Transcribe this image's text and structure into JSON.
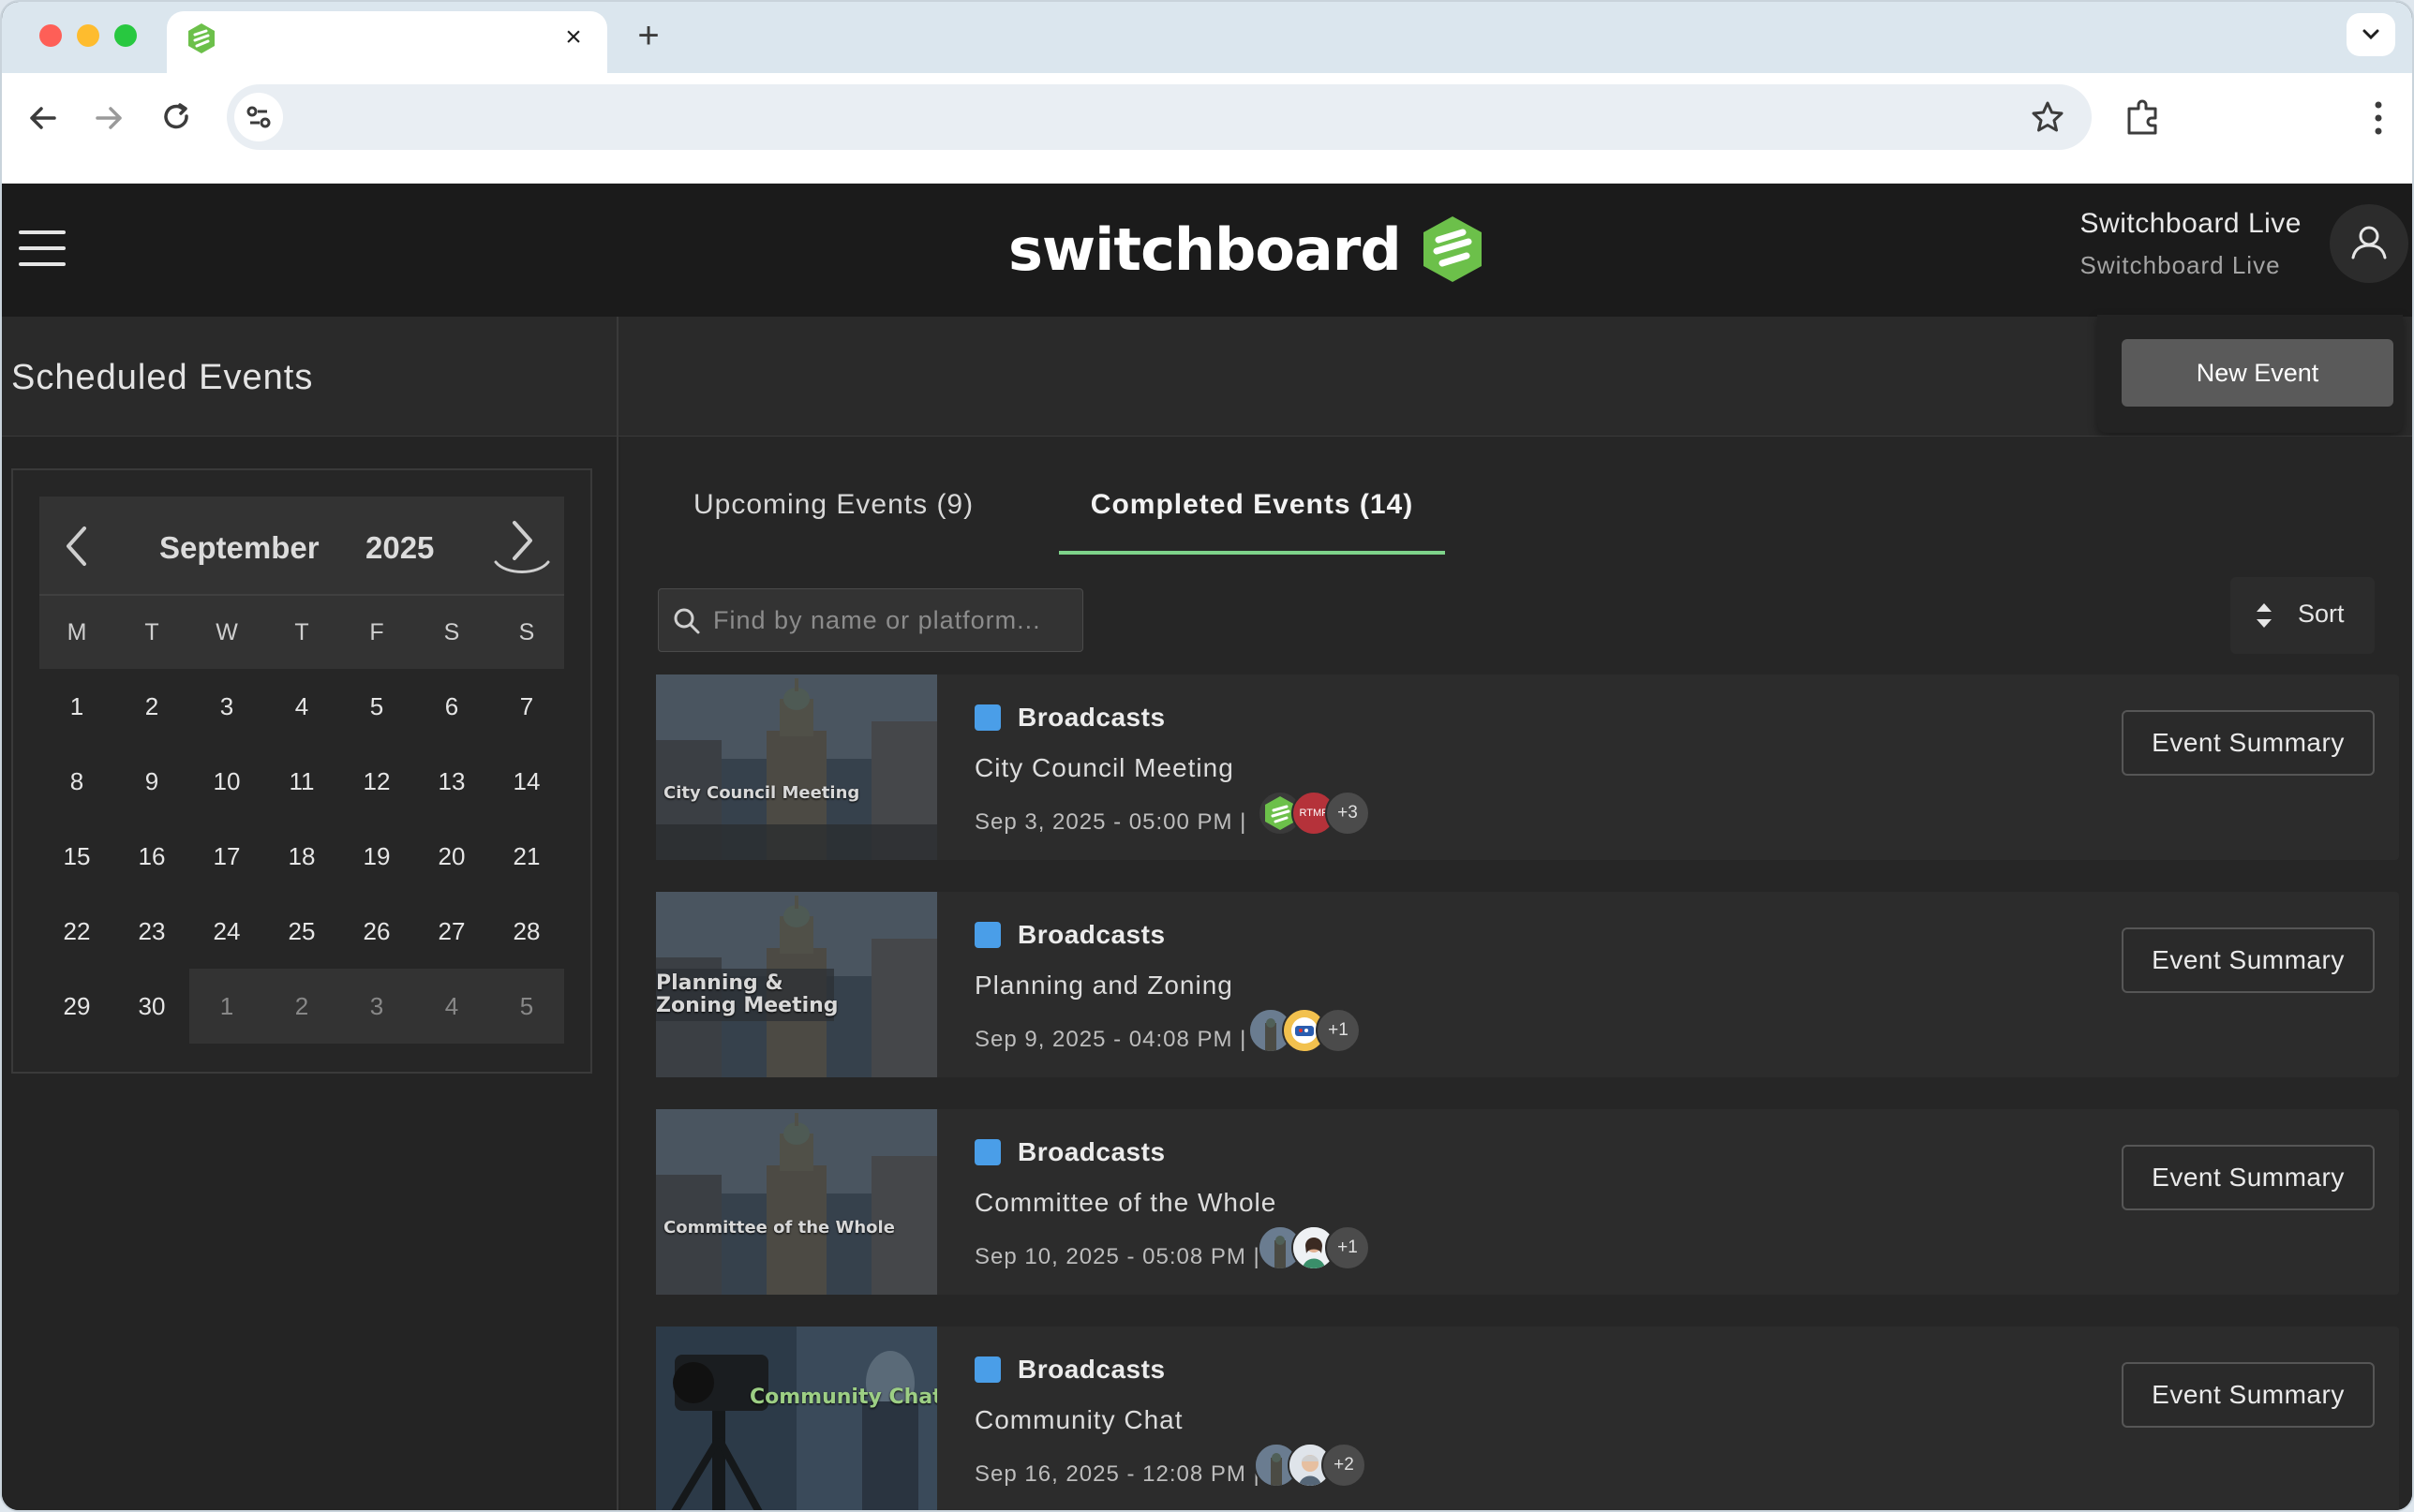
{
  "browser": {
    "tab_close": "×",
    "new_tab": "+"
  },
  "app": {
    "logo_text": "switchboard",
    "user": {
      "name": "Switchboard Live",
      "org": "Switchboard Live"
    }
  },
  "page": {
    "title": "Scheduled Events",
    "new_event_label": "New Event"
  },
  "calendar": {
    "month": "September",
    "year": "2025",
    "weekdays": [
      "M",
      "T",
      "W",
      "T",
      "F",
      "S",
      "S"
    ],
    "days": [
      "1",
      "2",
      "3",
      "4",
      "5",
      "6",
      "7",
      "8",
      "9",
      "10",
      "11",
      "12",
      "13",
      "14",
      "15",
      "16",
      "17",
      "18",
      "19",
      "20",
      "21",
      "22",
      "23",
      "24",
      "25",
      "26",
      "27",
      "28",
      "29",
      "30"
    ],
    "next_month_days": [
      "1",
      "2",
      "3",
      "4",
      "5"
    ]
  },
  "tabs": {
    "upcoming": "Upcoming Events (9)",
    "completed": "Completed Events (14)",
    "active": "completed"
  },
  "search": {
    "placeholder": "Find by name or platform..."
  },
  "sort": {
    "label": "Sort"
  },
  "events": [
    {
      "thumb_caption": "City Council Meeting",
      "tag": "Broadcasts",
      "name": "City Council Meeting",
      "date": "Sep 3, 2025 - 05:00 PM |",
      "more": "+3",
      "summary_label": "Event Summary"
    },
    {
      "thumb_caption": "Planning & Zoning Meeting",
      "tag": "Broadcasts",
      "name": "Planning and Zoning",
      "date": "Sep 9, 2025 - 04:08 PM |",
      "more": "+1",
      "summary_label": "Event Summary"
    },
    {
      "thumb_caption": "Committee of the Whole",
      "tag": "Broadcasts",
      "name": "Committee of the Whole",
      "date": "Sep 10, 2025 - 05:08 PM |",
      "more": "+1",
      "summary_label": "Event Summary"
    },
    {
      "thumb_caption": "Community Chat with the Mayor",
      "tag": "Broadcasts",
      "name": "Community Chat",
      "date": "Sep 16, 2025 - 12:08 PM |",
      "more": "+2",
      "summary_label": "Event Summary"
    }
  ],
  "avatar_rtmp_label": "RTMP",
  "colors": {
    "accent": "#7ed38a",
    "tag": "#4a9ee8",
    "brand_green": "#6cc04a"
  }
}
